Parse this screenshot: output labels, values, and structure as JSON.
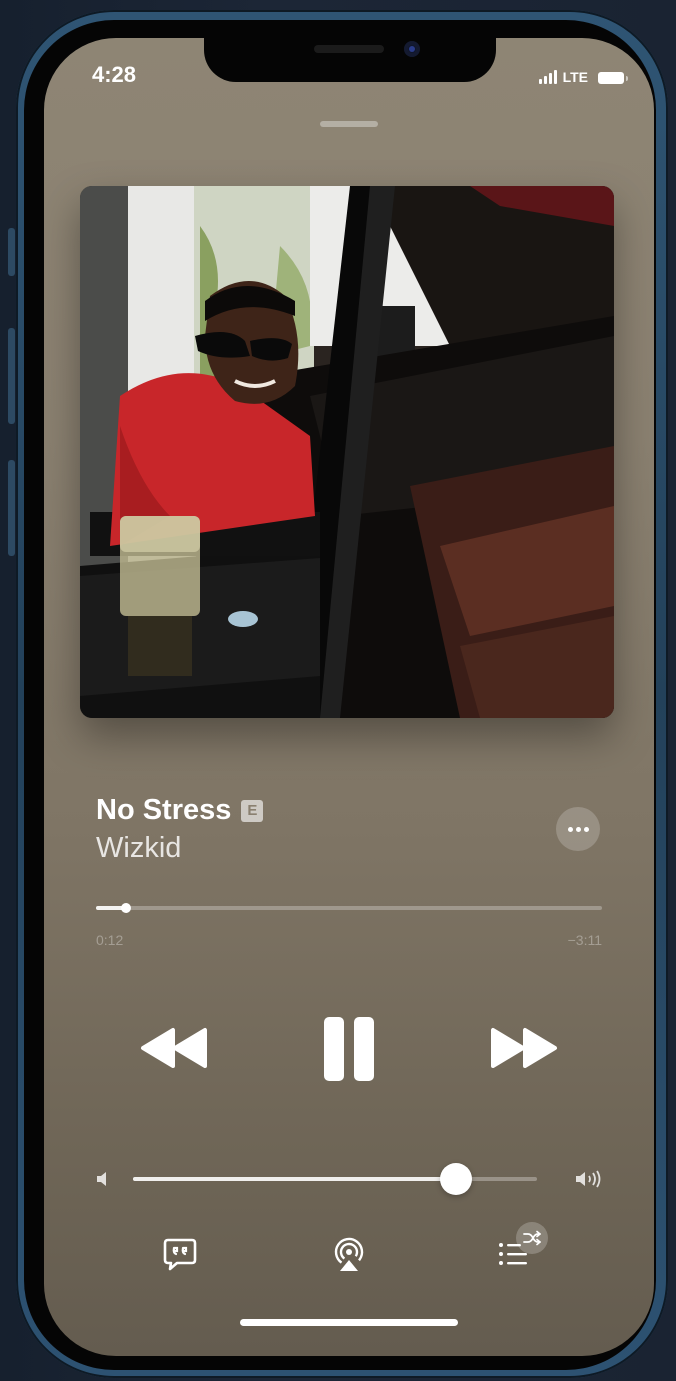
{
  "status_bar": {
    "time": "4:28",
    "network": "LTE",
    "signal_bars": 4,
    "battery_level": 0.8
  },
  "now_playing": {
    "title": "No Stress",
    "explicit_badge": "E",
    "artist": "Wizkid",
    "elapsed": "0:12",
    "remaining": "−3:11",
    "progress": 0.06,
    "volume": 0.8
  },
  "icons": {
    "more": "ellipsis-icon",
    "rewind": "rewind-icon",
    "pause": "pause-icon",
    "fast_forward": "fast-forward-icon",
    "volume_low": "speaker-low-icon",
    "volume_high": "speaker-high-icon",
    "lyrics": "lyrics-icon",
    "airplay": "airplay-icon",
    "queue": "queue-icon",
    "shuffle": "shuffle-icon"
  },
  "colors": {
    "screen_bg": "#8a8070",
    "frame": "#2f5574",
    "accent": "#ffffff"
  }
}
